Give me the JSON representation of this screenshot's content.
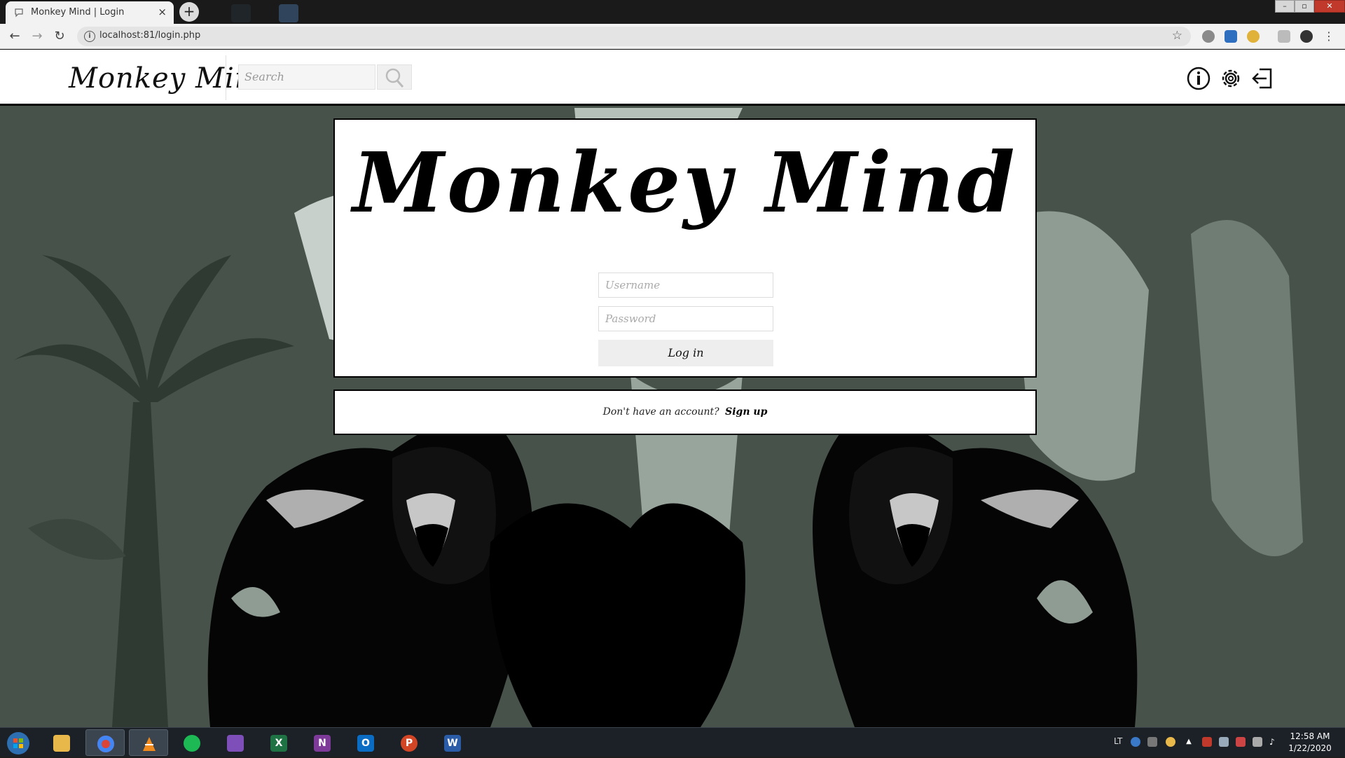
{
  "browser": {
    "tab_title": "Monkey Mind | Login",
    "tab_close": "×",
    "new_tab": "+",
    "url": "localhost:81/login.php",
    "back": "←",
    "forward": "→",
    "reload": "↻",
    "bookmark": "☆",
    "window_controls": [
      "–",
      "▫",
      "✕"
    ]
  },
  "site": {
    "logo": "Monkey Mind",
    "search_placeholder": "Search",
    "header_icons": [
      "info-icon",
      "settings-gear-icon",
      "logout-icon"
    ]
  },
  "login": {
    "title": "Monkey Mind",
    "username_placeholder": "Username",
    "password_placeholder": "Password",
    "login_button": "Log in",
    "signup_prompt": "Don't have an account?",
    "signup_link": "Sign up"
  },
  "taskbar": {
    "apps": [
      {
        "name": "File Explorer",
        "icon": "folder-icon",
        "color": "#e8b84a"
      },
      {
        "name": "Google Chrome",
        "icon": "chrome-icon",
        "color": "#db4437"
      },
      {
        "name": "VLC",
        "icon": "vlc-icon",
        "color": "#f08a1c"
      },
      {
        "name": "Spotify",
        "icon": "spotify-icon",
        "color": "#1db954"
      },
      {
        "name": "Visual Studio",
        "icon": "visual-studio-icon",
        "color": "#7e4fb8"
      },
      {
        "name": "Excel",
        "icon": "excel-icon",
        "color": "#1f7244"
      },
      {
        "name": "OneNote",
        "icon": "onenote-icon",
        "color": "#7e3a99"
      },
      {
        "name": "Outlook",
        "icon": "outlook-icon",
        "color": "#0b6cc4"
      },
      {
        "name": "PowerPoint",
        "icon": "powerpoint-icon",
        "color": "#d24625"
      },
      {
        "name": "Word",
        "icon": "word-icon",
        "color": "#2b5ca8"
      }
    ],
    "language": "LT",
    "time": "12:58 AM",
    "date": "1/22/2020"
  },
  "colors": {
    "background_jungle": "#47524b",
    "foliage_light": "#8e9c93",
    "card_bg": "#ffffff",
    "button_bg": "#eeeeee"
  }
}
